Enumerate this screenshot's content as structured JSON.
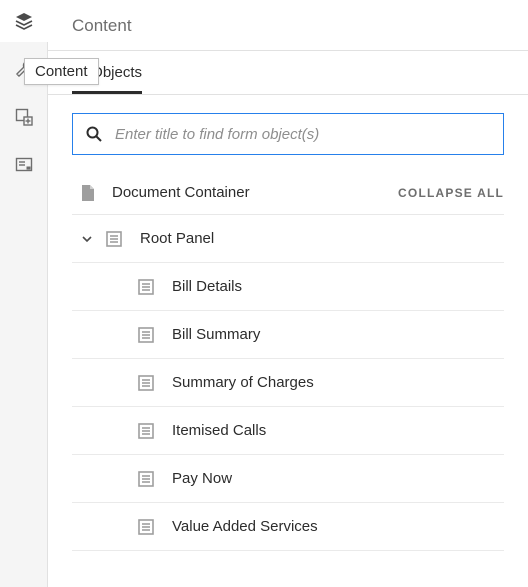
{
  "panel_title": "Content",
  "tooltip": "Content",
  "tab_label": "Objects",
  "search_placeholder": "Enter title to find form object(s)",
  "collapse_all": "Collapse All",
  "doc_container": "Document Container",
  "root_panel": "Root Panel",
  "children": [
    "Bill Details",
    "Bill Summary",
    "Summary of Charges",
    "Itemised Calls",
    "Pay Now",
    "Value Added Services"
  ]
}
